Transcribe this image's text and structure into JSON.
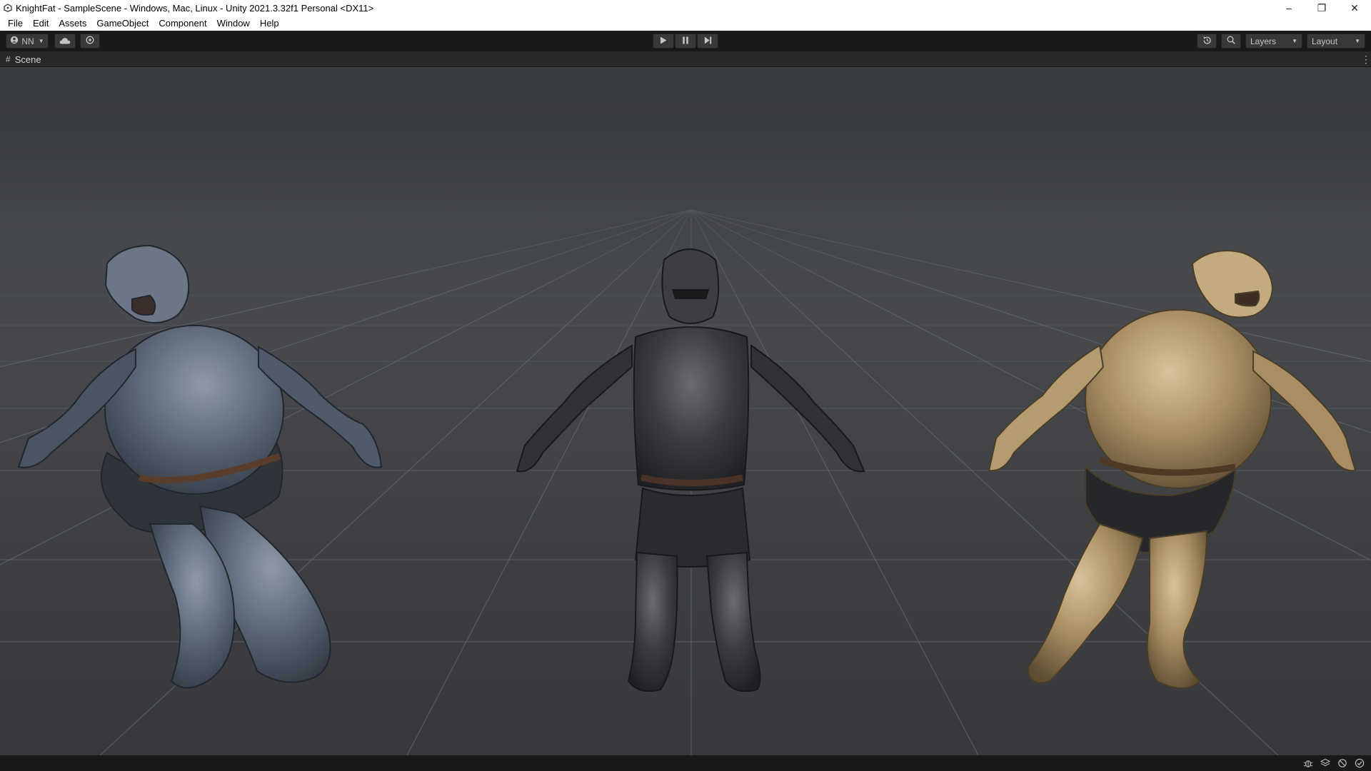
{
  "window": {
    "title": "KnightFat - SampleScene - Windows, Mac, Linux - Unity 2021.3.32f1 Personal <DX11>",
    "controls": {
      "minimize": "–",
      "restore": "❐",
      "close": "✕"
    }
  },
  "menu": {
    "items": [
      {
        "label": "File"
      },
      {
        "label": "Edit"
      },
      {
        "label": "Assets"
      },
      {
        "label": "GameObject"
      },
      {
        "label": "Component"
      },
      {
        "label": "Window"
      },
      {
        "label": "Help"
      }
    ]
  },
  "toolbar": {
    "account_label": "NN",
    "layers_label": "Layers",
    "layout_label": "Layout",
    "icons": {
      "account": "account-icon",
      "cloud": "cloud-icon",
      "collab": "collab-icon",
      "play": "play-icon",
      "pause": "pause-icon",
      "step": "step-icon",
      "history": "history-icon",
      "search": "search-icon"
    }
  },
  "scene": {
    "tab_label": "Scene",
    "knights": [
      {
        "name": "knight-blue-steel",
        "color": "#5b6878"
      },
      {
        "name": "knight-black-steel",
        "color": "#34363a"
      },
      {
        "name": "knight-gold",
        "color": "#a58c62"
      }
    ]
  },
  "status": {
    "icons": [
      "bug-icon",
      "layers-icon",
      "hierarchy-icon",
      "check-icon"
    ]
  }
}
